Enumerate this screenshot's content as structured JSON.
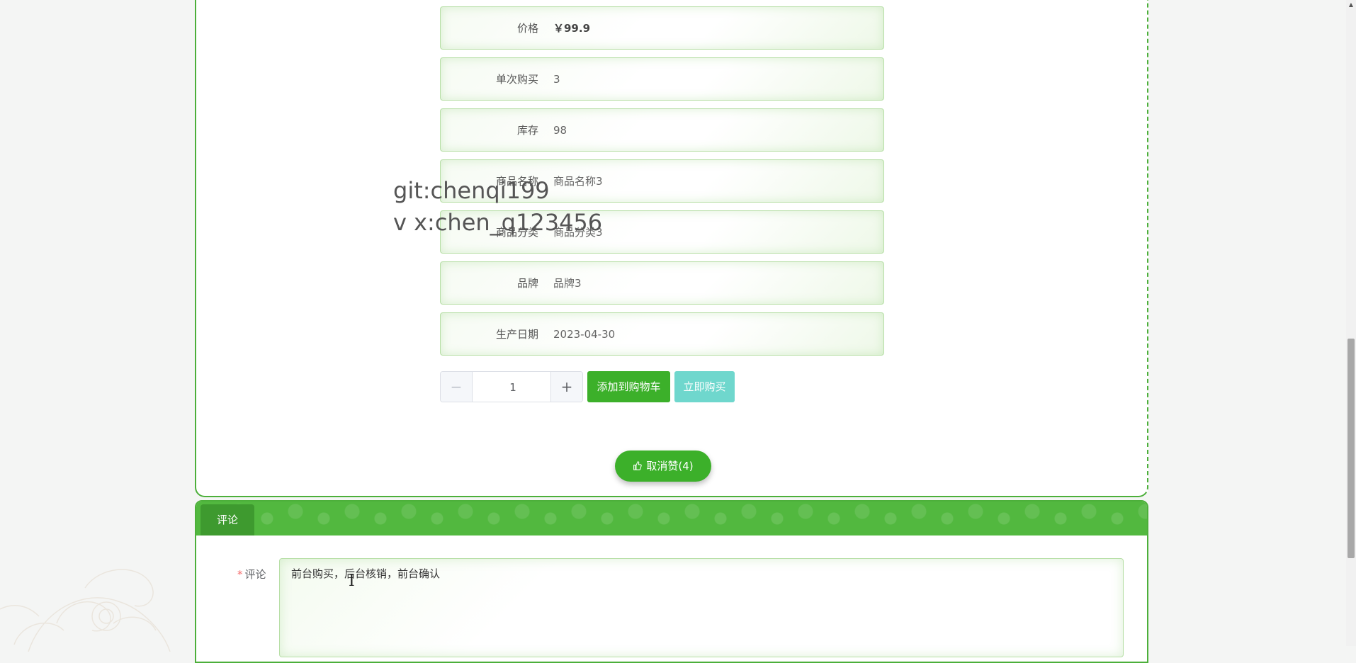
{
  "product": {
    "fields": [
      {
        "label": "价格",
        "value": "￥99.9"
      },
      {
        "label": "单次购买",
        "value": "3"
      },
      {
        "label": "库存",
        "value": "98"
      },
      {
        "label": "商品名称",
        "value": "商品名称3"
      },
      {
        "label": "商品分类",
        "value": "商品分类3"
      },
      {
        "label": "品牌",
        "value": "品牌3"
      },
      {
        "label": "生产日期",
        "value": "2023-04-30"
      }
    ],
    "quantity": "1",
    "add_to_cart_label": "添加到购物车",
    "buy_now_label": "立即购买",
    "like_label": "取消赞(4)"
  },
  "watermark": {
    "line1": "git:chenqi199",
    "line2": "v x:chen_q123456"
  },
  "comment": {
    "tab_title": "评论",
    "label": "评论",
    "required_mark": "*",
    "text": "前台购买，后台核销，前台确认"
  },
  "colors": {
    "primary_green": "#3cb02a",
    "buy_now": "#6fd7cd",
    "border_green": "#4caf3a"
  },
  "icons": {
    "like": "thumbs-up-icon",
    "minus": "minus-icon",
    "plus": "plus-icon"
  }
}
